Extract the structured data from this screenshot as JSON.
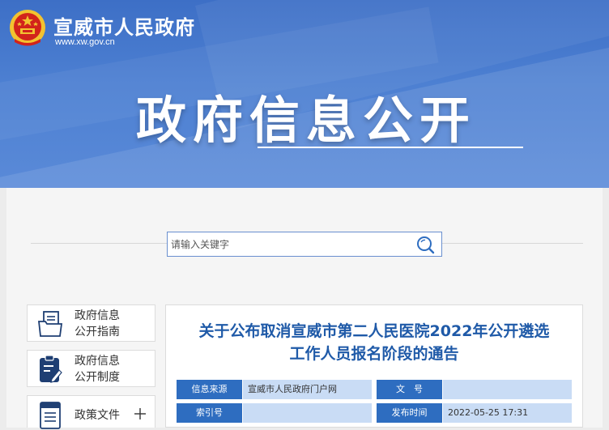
{
  "header": {
    "site_name": "宣威市人民政府",
    "site_url": "www.xw.gov.cn",
    "hero_title": "政府信息公开"
  },
  "search": {
    "placeholder": "请输入关键字",
    "value": ""
  },
  "sidebar": {
    "items": [
      {
        "line1": "政府信息",
        "line2": "公开指南",
        "icon": "folder-document-icon"
      },
      {
        "line1": "政府信息",
        "line2": "公开制度",
        "icon": "clipboard-edit-icon"
      },
      {
        "line1": "政策文件",
        "icon": "document-list-icon",
        "expand_icon": "plus-icon"
      }
    ]
  },
  "article": {
    "title_line1": "关于公布取消宣威市第二人民医院2022年公开遴选",
    "title_line2": "工作人员报名阶段的通告",
    "meta": {
      "source_label": "信息来源",
      "source_value": "宣威市人民政府门户网",
      "doc_no_label": "文　号",
      "doc_no_value": "",
      "index_label": "索引号",
      "index_value": "",
      "date_label": "发布时间",
      "date_value": "2022-05-25 17:31"
    }
  },
  "colors": {
    "banner_blue": "#4a7dd0",
    "title_blue": "#1f5aa8",
    "label_blue": "#2e6dc0",
    "value_blue": "#c9dcf5",
    "emblem_red": "#d2231b",
    "emblem_gold": "#f2c230"
  }
}
